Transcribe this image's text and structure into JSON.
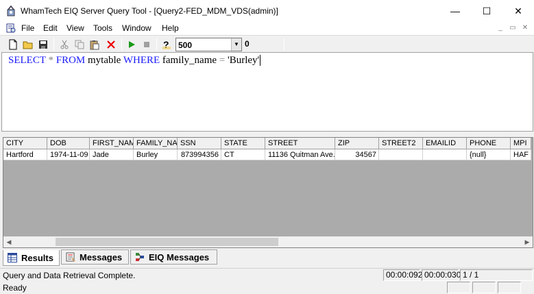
{
  "window": {
    "title": "WhamTech EIQ Server Query Tool - [Query2-FED_MDM_VDS(admin)]",
    "minimize": "—",
    "maximize": "☐",
    "close": "✕"
  },
  "menu": {
    "items": [
      {
        "label": "File"
      },
      {
        "label": "Edit"
      },
      {
        "label": "View"
      },
      {
        "label": "Tools"
      },
      {
        "label": "Window"
      },
      {
        "label": "Help"
      }
    ],
    "mdi_min": "_",
    "mdi_restore": "▭",
    "mdi_close": "✕"
  },
  "toolbar": {
    "buttons": [
      "new-file-icon",
      "open-folder-icon",
      "save-icon",
      "cut-icon",
      "copy-icon",
      "paste-icon",
      "delete-icon",
      "run-icon",
      "stop-icon",
      "help-icon"
    ],
    "row_limit": "500",
    "row_count": "0"
  },
  "query": {
    "kw_select": "SELECT",
    "star": "*",
    "kw_from": "FROM",
    "table": "mytable",
    "kw_where": "WHERE",
    "column": "family_name",
    "eq": "=",
    "value": "'Burley'"
  },
  "grid": {
    "columns": [
      "CITY",
      "DOB",
      "FIRST_NAM",
      "FAMILY_NA",
      "SSN",
      "STATE",
      "STREET",
      "ZIP",
      "STREET2",
      "EMAILID",
      "PHONE",
      "MPI"
    ],
    "rows": [
      [
        "Hartford",
        "1974-11-09",
        "Jade",
        "Burley",
        "873994356",
        "CT",
        "11136 Quitman Ave.",
        "34567",
        "",
        "",
        "{null}",
        "HAF"
      ]
    ],
    "scroll_left": "◀",
    "scroll_right": "▶"
  },
  "tabs": [
    {
      "label": "Results",
      "active": true
    },
    {
      "label": "Messages"
    },
    {
      "label": "EIQ Messages"
    }
  ],
  "status": {
    "message": "Query and Data Retrieval Complete.",
    "time1": "00:00:092",
    "time2": "00:00:030",
    "page": "1 / 1",
    "ready": "Ready"
  },
  "colors": {
    "keyword": "#1a1aff",
    "operator": "#808080",
    "grid_empty": "#ababab"
  }
}
